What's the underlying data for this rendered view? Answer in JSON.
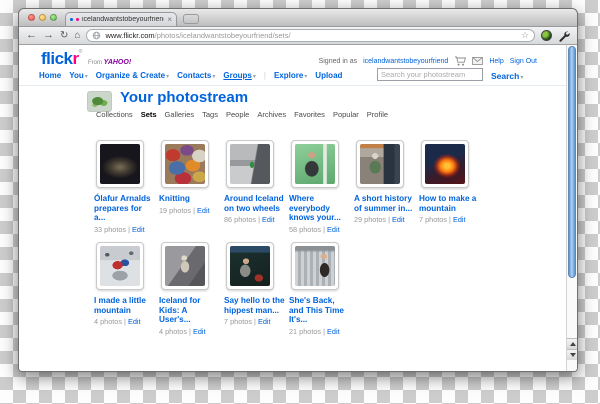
{
  "browser": {
    "tab": {
      "title": "icelandwantstobeyourfriend's"
    },
    "url": {
      "domain": "www.flickr.com",
      "path": "/photos/icelandwantstobeyourfriend/sets/"
    }
  },
  "icons": {
    "back": "←",
    "forward": "→",
    "reload": "↻",
    "home": "⌂",
    "star": "☆",
    "close": "×",
    "caret": "▾",
    "divider": "|",
    "registered": "®"
  },
  "flickr_header": {
    "logo_flick": "flick",
    "logo_r": "r",
    "from_label": "From",
    "yahoo_label": "YAHOO!",
    "signed_in_prefix": "Signed in as",
    "username": "icelandwantstobeyourfriend",
    "help_label": "Help",
    "sign_out_label": "Sign Out",
    "nav": {
      "home": "Home",
      "you": "You",
      "organize": "Organize & Create",
      "contacts": "Contacts",
      "groups": "Groups",
      "explore": "Explore",
      "upload": "Upload"
    },
    "search": {
      "placeholder": "Search your photostream",
      "button_label": "Search"
    }
  },
  "main": {
    "page_title": "Your photostream",
    "tabs": [
      "Collections",
      "Sets",
      "Galleries",
      "Tags",
      "People",
      "Archives",
      "Favorites",
      "Popular",
      "Profile"
    ],
    "active_tab": "Sets",
    "edit_label": "Edit",
    "count_divider": "|",
    "sets": [
      {
        "title": "Ólafur Arnalds prepares for a...",
        "count_label": "33 photos",
        "image_alt": "dark concert stage"
      },
      {
        "title": "Knitting",
        "count_label": "19 photos",
        "image_alt": "pile of colorful knitted wool"
      },
      {
        "title": "Around Iceland on two wheels",
        "count_label": "86 photos",
        "image_alt": "cyclist on grey mountain road"
      },
      {
        "title": "Where everybody knows your...",
        "count_label": "58 photos",
        "image_alt": "man in front of green wall"
      },
      {
        "title": "A short history of summer in...",
        "count_label": "29 photos",
        "image_alt": "man at computer desk"
      },
      {
        "title": "How to make a mountain",
        "count_label": "7 photos",
        "image_alt": "volcano erupting at night"
      },
      {
        "title": "I made a little mountain",
        "count_label": "4 photos",
        "image_alt": "red and blue jeep in snow"
      },
      {
        "title": "Iceland for Kids: A User's...",
        "count_label": "4 photos",
        "image_alt": "person seen from above on street"
      },
      {
        "title": "Say hello to the hippest man...",
        "count_label": "7 photos",
        "image_alt": "man sitting in dark room"
      },
      {
        "title": "She's Back, and This Time It's...",
        "count_label": "21 photos",
        "image_alt": "woman in front of waterfall"
      }
    ]
  },
  "colors": {
    "flickr_blue": "#0063dc",
    "flickr_pink": "#ff0084",
    "link_blue": "#0063dc",
    "count_grey": "#999999"
  }
}
